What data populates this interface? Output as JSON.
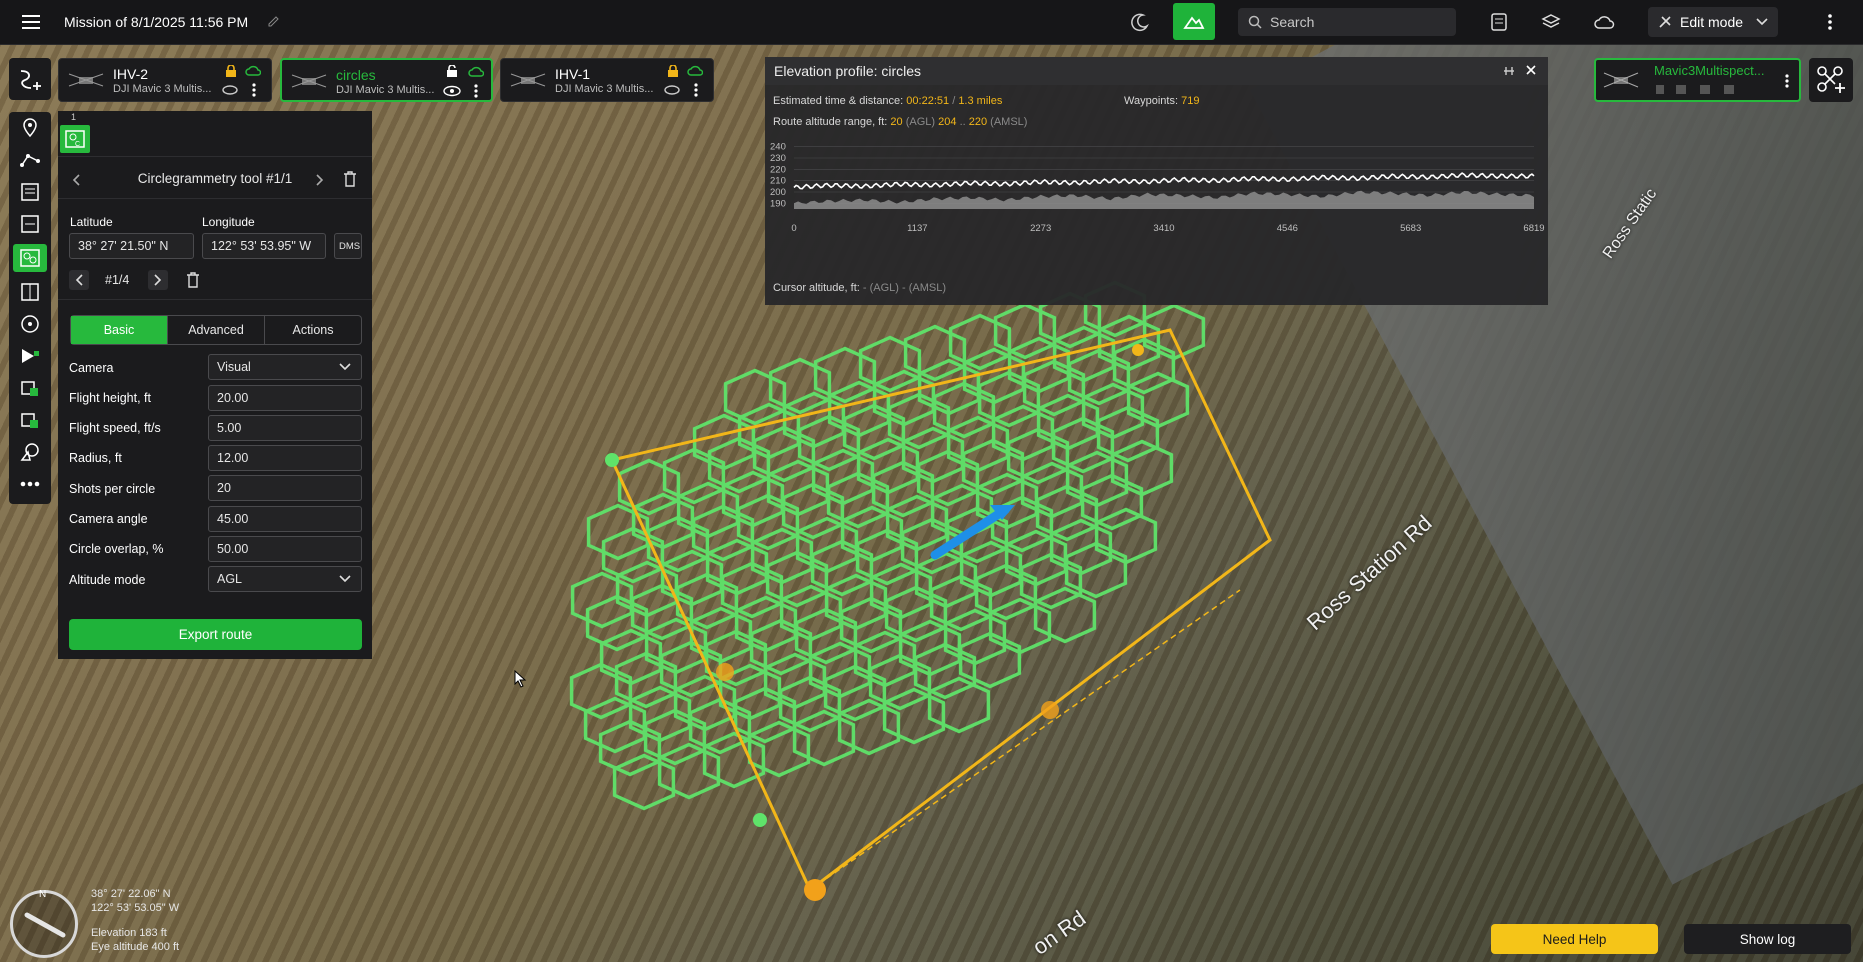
{
  "topbar": {
    "mission_title": "Mission of 8/1/2025 11:56 PM",
    "search_placeholder": "Search",
    "mode_label": "Edit mode"
  },
  "vehicles": [
    {
      "name": "IHV-2",
      "model": "DJI Mavic 3 Multis...",
      "active": false
    },
    {
      "name": "circles",
      "model": "DJI Mavic 3 Multis...",
      "active": true
    },
    {
      "name": "IHV-1",
      "model": "DJI Mavic 3 Multis...",
      "active": false
    }
  ],
  "panel": {
    "step_number": "1",
    "tool_title": "Circlegrammetry tool #1/1",
    "latitude_label": "Latitude",
    "longitude_label": "Longitude",
    "latitude_value": "38° 27' 21.50\" N",
    "longitude_value": "122° 53' 53.95\" W",
    "dms_label": "DMS",
    "point_index": "#1/4",
    "tabs": [
      "Basic",
      "Advanced",
      "Actions"
    ],
    "active_tab": "Basic",
    "fields": [
      {
        "label": "Camera",
        "value": "Visual",
        "type": "select"
      },
      {
        "label": "Flight height, ft",
        "value": "20.00",
        "type": "input"
      },
      {
        "label": "Flight speed, ft/s",
        "value": "5.00",
        "type": "input"
      },
      {
        "label": "Radius, ft",
        "value": "12.00",
        "type": "input"
      },
      {
        "label": "Shots per circle",
        "value": "20",
        "type": "input"
      },
      {
        "label": "Camera angle",
        "value": "45.00",
        "type": "input"
      },
      {
        "label": "Circle overlap, %",
        "value": "50.00",
        "type": "input"
      },
      {
        "label": "Altitude mode",
        "value": "AGL",
        "type": "select"
      }
    ],
    "export_label": "Export route"
  },
  "elevation": {
    "title": "Elevation profile: circles",
    "time_distance_label": "Estimated time & distance:",
    "time_value": "00:22:51",
    "distance_value": "1.3 miles",
    "waypoints_label": "Waypoints:",
    "waypoints_value": "719",
    "range_label": "Route altitude range, ft:",
    "agl_value": "20",
    "agl_unit": "(AGL)",
    "amsl_min": "204",
    "amsl_sep": "..",
    "amsl_max": "220",
    "amsl_unit": "(AMSL)",
    "cursor_label": "Cursor altitude, ft:",
    "cursor_agl": "- (AGL)",
    "cursor_amsl": "- (AMSL)",
    "chart_data": {
      "type": "area",
      "y_ticks": [
        "240",
        "230",
        "220",
        "210",
        "200",
        "190"
      ],
      "x_ticks": [
        "0",
        "1137",
        "2273",
        "3410",
        "4546",
        "5683",
        "6819"
      ],
      "ylim": [
        185,
        245
      ],
      "xlim": [
        0,
        6819
      ],
      "series": [
        {
          "values": [
            204,
            206,
            205,
            207,
            206,
            208,
            207,
            209,
            208,
            210,
            209,
            211,
            210,
            212,
            211,
            213,
            212,
            214,
            213,
            215,
            214,
            214
          ]
        },
        {
          "values": [
            190,
            192,
            193,
            191,
            194,
            195,
            193,
            196,
            197,
            194,
            198,
            197,
            195,
            199,
            198,
            196,
            200,
            199,
            197,
            200,
            198,
            197
          ]
        }
      ]
    }
  },
  "top_right_vehicle": {
    "name": "Mavic3Multispect..."
  },
  "map": {
    "road_label_1": "Ross Station Rd",
    "road_label_2": "Ross Static",
    "road_label_3": "on Rd",
    "center_lat": "38° 27' 22.06\" N",
    "center_lon": "122° 53' 53.05\" W",
    "elevation": "Elevation 183 ft",
    "eye_altitude": "Eye altitude 400 ft",
    "compass_n": "N"
  },
  "help_label": "Need Help",
  "log_label": "Show log",
  "colors": {
    "accent": "#27b93d",
    "warning": "#f2b619",
    "help": "#f5c518"
  }
}
